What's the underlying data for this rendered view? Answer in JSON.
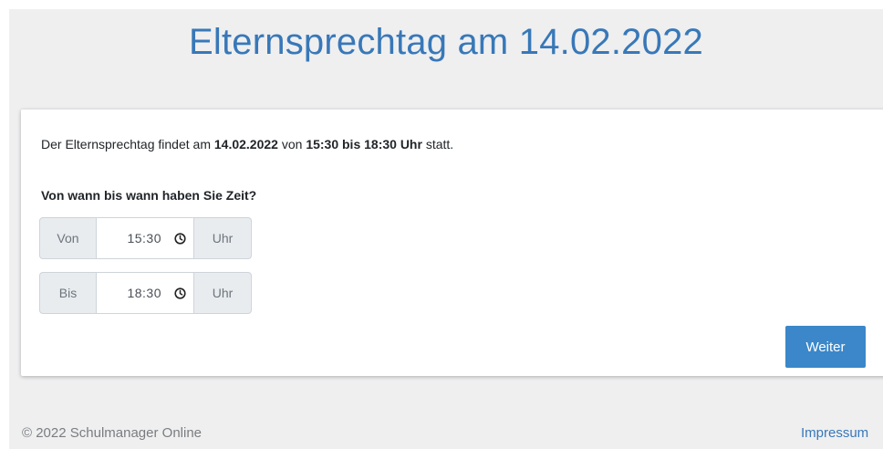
{
  "header": {
    "title": "Elternsprechtag am 14.02.2022"
  },
  "info": {
    "prefix": "Der Elternsprechtag findet am ",
    "date": "14.02.2022",
    "mid": " von ",
    "timespan": "15:30 bis 18:30 Uhr",
    "suffix": " statt."
  },
  "form": {
    "question": "Von wann bis wann haben Sie Zeit?",
    "from": {
      "label": "Von",
      "value": "15:30",
      "unit": "Uhr"
    },
    "to": {
      "label": "Bis",
      "value": "18:30",
      "unit": "Uhr"
    },
    "submit_label": "Weiter"
  },
  "footer": {
    "copyright": "© 2022 Schulmanager Online",
    "impressum": "Impressum"
  },
  "colors": {
    "accent": "#3878b8",
    "button": "#3b87c9",
    "background": "#efeff0"
  },
  "icons": {
    "time": "clock-icon"
  }
}
